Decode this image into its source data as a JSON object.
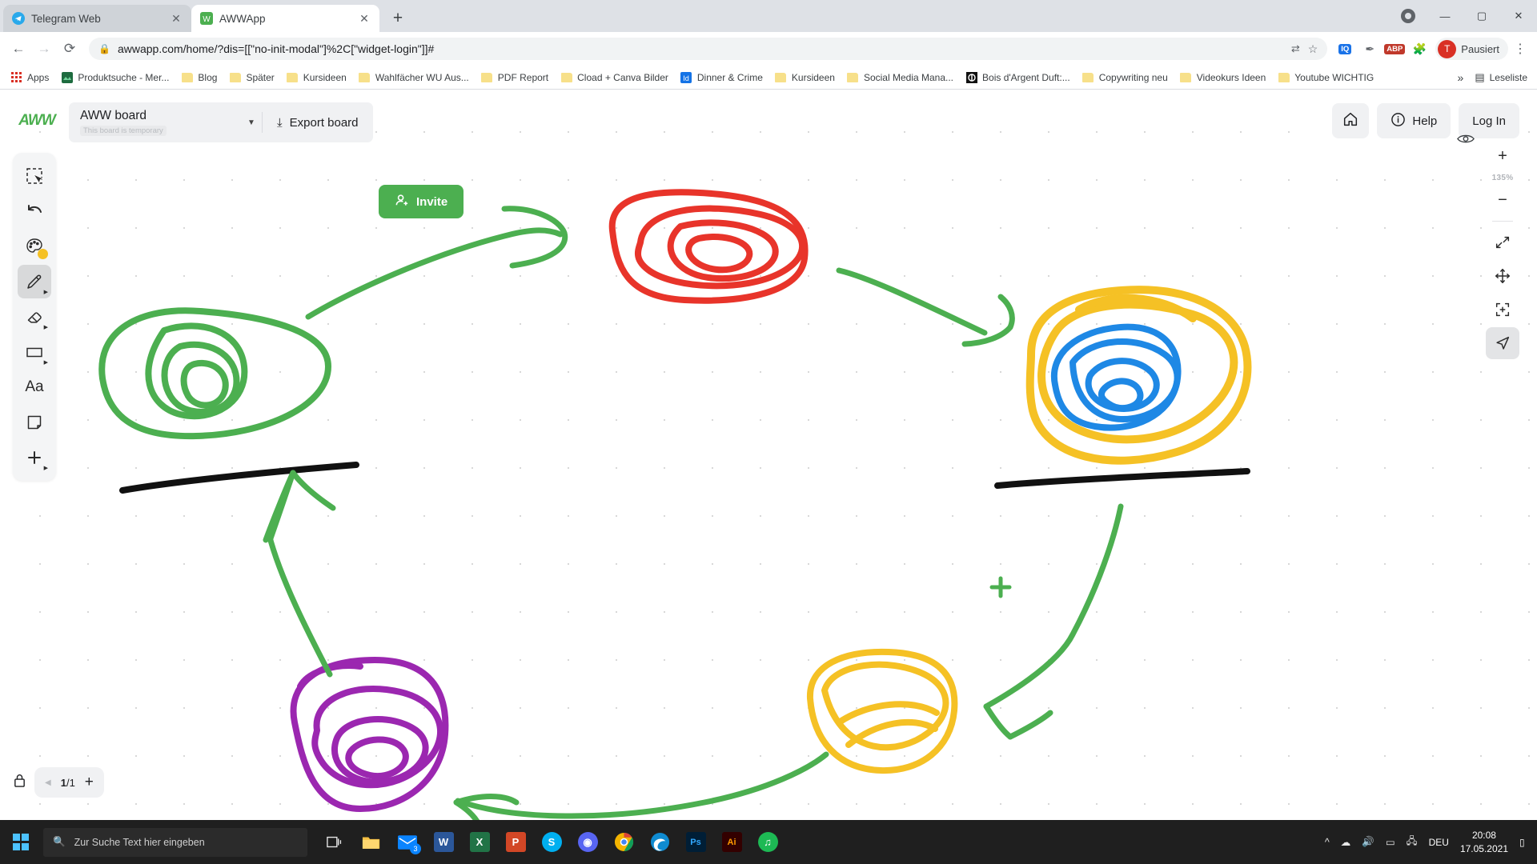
{
  "browser": {
    "tabs": [
      {
        "title": "Telegram Web",
        "icon": "telegram-icon",
        "active": false
      },
      {
        "title": "AWWApp",
        "icon": "awwapp-icon",
        "active": true
      }
    ],
    "new_tab_label": "+",
    "window_controls": {
      "record": "record-indicator",
      "minimize": "—",
      "maximize": "□",
      "close": "✕"
    },
    "nav": {
      "back": "←",
      "forward": "→",
      "reload": "⟳"
    },
    "omnibox": {
      "url": "awwapp.com/home/?dis=[[\"no-init-modal\"]%2C[\"widget-login\"]]#",
      "lock_icon": "lock-icon",
      "translate_icon": "translate-icon",
      "star_icon": "star-icon"
    },
    "extensions": [
      {
        "name": "iq-extension",
        "label": "IQ",
        "color": "#1a73e8"
      },
      {
        "name": "grammar-extension",
        "label": "✎",
        "color": "#5f6368"
      },
      {
        "name": "abp-extension",
        "label": "ABP",
        "color": "#c0392b"
      },
      {
        "name": "puzzle-extension",
        "label": "🧩",
        "color": "#5f6368"
      }
    ],
    "profile": {
      "initial": "T",
      "label": "Pausiert"
    },
    "menu_icon": "kebab-menu-icon",
    "bookmarks": [
      {
        "label": "Apps",
        "icon": "apps-grid-icon"
      },
      {
        "label": "Produktsuche - Mer...",
        "icon": "site-icon-green"
      },
      {
        "label": "Blog",
        "icon": "folder-icon"
      },
      {
        "label": "Später",
        "icon": "folder-icon"
      },
      {
        "label": "Kursideen",
        "icon": "folder-icon"
      },
      {
        "label": "Wahlfächer WU Aus...",
        "icon": "folder-icon"
      },
      {
        "label": "PDF Report",
        "icon": "folder-icon"
      },
      {
        "label": "Cload + Canva Bilder",
        "icon": "folder-icon"
      },
      {
        "label": "Dinner & Crime",
        "icon": "indesign-icon"
      },
      {
        "label": "Kursideen",
        "icon": "folder-icon"
      },
      {
        "label": "Social Media Mana...",
        "icon": "folder-icon"
      },
      {
        "label": "Bois d'Argent Duft:...",
        "icon": "dior-icon"
      },
      {
        "label": "Copywriting neu",
        "icon": "folder-icon"
      },
      {
        "label": "Videokurs Ideen",
        "icon": "folder-icon"
      },
      {
        "label": "Youtube WICHTIG",
        "icon": "folder-icon"
      }
    ],
    "bookmarks_overflow": "»",
    "reading_list": {
      "label": "Leseliste",
      "icon": "reading-list-icon"
    }
  },
  "app": {
    "logo": "AWW",
    "board": {
      "name": "AWW board",
      "temporary_badge": "This board is temporary",
      "caret": "▼"
    },
    "export_label": "Export board",
    "export_icon": "download-icon",
    "invite_label": "Invite",
    "invite_icon": "invite-user-icon",
    "top_right": {
      "home_icon": "home-icon",
      "help_label": "Help",
      "help_icon": "info-circle-icon",
      "login_label": "Log In"
    },
    "tools": [
      {
        "name": "select-tool",
        "icon": "marquee-select-icon",
        "active": false,
        "has_submenu": false
      },
      {
        "name": "undo-tool",
        "icon": "undo-arrow-icon",
        "active": false,
        "has_submenu": false
      },
      {
        "name": "color-tool",
        "icon": "palette-icon",
        "active": false,
        "has_submenu": false,
        "swatch": "#f5c125"
      },
      {
        "name": "pen-tool",
        "icon": "pencil-icon",
        "active": true,
        "has_submenu": true
      },
      {
        "name": "eraser-tool",
        "icon": "eraser-icon",
        "active": false,
        "has_submenu": true
      },
      {
        "name": "shape-tool",
        "icon": "rectangle-icon",
        "active": false,
        "has_submenu": true
      },
      {
        "name": "text-tool",
        "icon": "text-aa-icon",
        "active": false,
        "has_submenu": false,
        "label": "Aa"
      },
      {
        "name": "note-tool",
        "icon": "sticky-note-icon",
        "active": false,
        "has_submenu": false
      },
      {
        "name": "add-tool",
        "icon": "plus-icon",
        "active": false,
        "has_submenu": true
      }
    ],
    "zoom_controls": {
      "eye_icon": "eye-visibility-icon",
      "zoom_in": "+",
      "zoom_level": "135%",
      "zoom_out": "−",
      "fit_icon": "fit-screen-icon",
      "pan_icon": "move-pan-icon",
      "center_icon": "center-focus-icon",
      "pointer_icon": "cursor-pointer-icon"
    },
    "pages": {
      "lock_icon": "lock-board-icon",
      "prev_icon": "◀",
      "current": "1",
      "separator": "/",
      "total": "1",
      "add_icon": "+"
    },
    "drawing_colors": {
      "green": "#4caf50",
      "red": "#e8342a",
      "yellow": "#f5c125",
      "blue": "#1e88e5",
      "purple": "#9b27b0",
      "black": "#111111"
    }
  },
  "taskbar": {
    "start_icon": "windows-logo-icon",
    "search_placeholder": "Zur Suche Text hier eingeben",
    "search_icon": "search-icon",
    "items": [
      {
        "name": "task-view",
        "label": "⊞",
        "color": "#2b2b2b"
      },
      {
        "name": "file-explorer",
        "label": "📁",
        "color": "#f5bf42"
      },
      {
        "name": "mail-app",
        "label": "✉",
        "color": "#0a84ff",
        "badge": "3"
      },
      {
        "name": "word-app",
        "label": "W",
        "color": "#2b579a"
      },
      {
        "name": "excel-app",
        "label": "X",
        "color": "#217346"
      },
      {
        "name": "powerpoint-app",
        "label": "P",
        "color": "#d24726"
      },
      {
        "name": "skype-app",
        "label": "S",
        "color": "#00aff0"
      },
      {
        "name": "discord-app",
        "label": "◉",
        "color": "#5865f2"
      },
      {
        "name": "chrome-app",
        "label": "◎",
        "color": "#4285f4"
      },
      {
        "name": "edge-app",
        "label": "e",
        "color": "#0f8bd1"
      },
      {
        "name": "photoshop-app",
        "label": "Ps",
        "color": "#31a8ff"
      },
      {
        "name": "illustrator-app",
        "label": "Ai",
        "color": "#ff9a00"
      },
      {
        "name": "spotify-app",
        "label": "♫",
        "color": "#1db954"
      }
    ],
    "tray": {
      "chevron": "^",
      "cloud_icon": "onedrive-icon",
      "volume_icon": "volume-icon",
      "battery_icon": "battery-icon",
      "network_icon": "network-icon",
      "language": "DEU",
      "time": "20:08",
      "date": "17.05.2021",
      "notification_icon": "notification-icon"
    }
  }
}
